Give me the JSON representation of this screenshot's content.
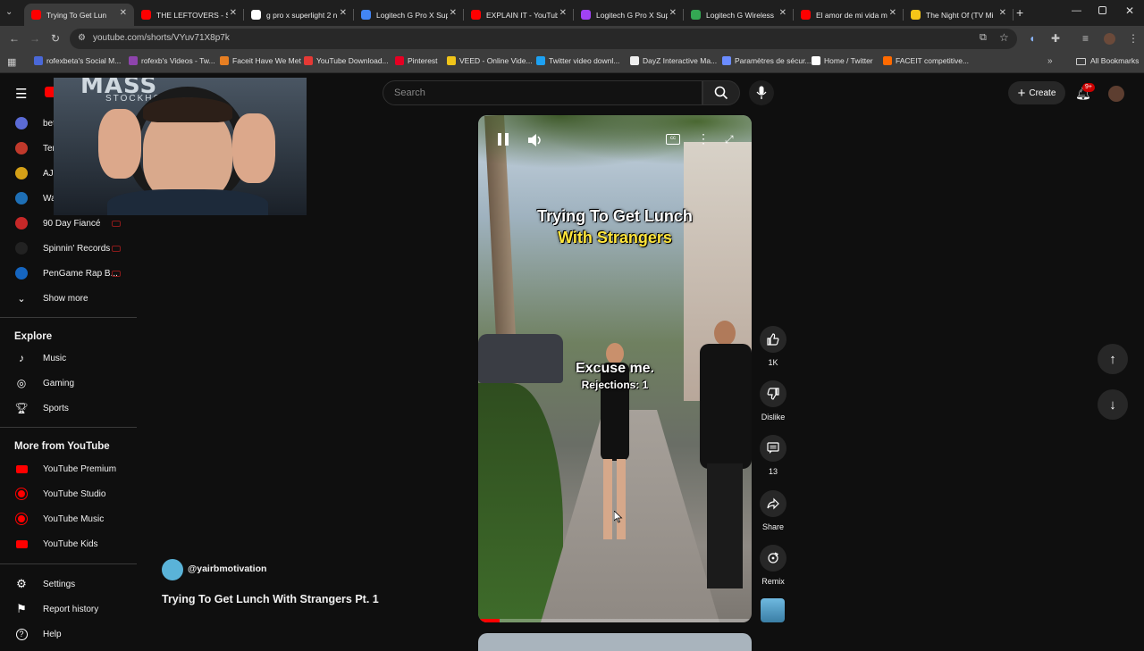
{
  "browser": {
    "tabs": [
      {
        "title": "Trying To Get Lun",
        "color": "#ff0000"
      },
      {
        "title": "THE LEFTOVERS - Sea",
        "color": "#ff0000"
      },
      {
        "title": "g pro x superlight 2 n",
        "color": "#ffffff"
      },
      {
        "title": "Logitech G Pro X Sup",
        "color": "#4285f4"
      },
      {
        "title": "EXPLAIN IT - YouTub",
        "color": "#ff0000"
      },
      {
        "title": "Logitech G Pro X Sup",
        "color": "#a142f4"
      },
      {
        "title": "Logitech G Wireless",
        "color": "#34a853"
      },
      {
        "title": "El amor de mi vida m",
        "color": "#ff0000"
      },
      {
        "title": "The Night Of (TV Mi",
        "color": "#f5c518"
      }
    ],
    "url": "youtube.com/shorts/VYuv71X8p7k",
    "bookmarks": [
      "rofexbeta's Social M...",
      "rofexb's Videos - Tw...",
      "Faceit Have We Met",
      "YouTube Download...",
      "Pinterest",
      "VEED - Online Vide...",
      "Twitter video downl...",
      "DayZ Interactive Ma...",
      "Paramètres de sécur...",
      "Home / Twitter",
      "FACEIT competitive..."
    ],
    "all_bookmarks": "All Bookmarks"
  },
  "header": {
    "search_placeholder": "Search",
    "create_label": "Create",
    "notif_count": "9+"
  },
  "sidebar": {
    "subscriptions": [
      {
        "label": "bet",
        "color": "#5b6bd6"
      },
      {
        "label": "Ter",
        "color": "#c0392b"
      },
      {
        "label": "AJ",
        "color": "#d4a017"
      },
      {
        "label": "Wa",
        "color": "#1e6fb5"
      },
      {
        "label": "90 Day Fiancé",
        "color": "#c62828"
      },
      {
        "label": "Spinnin' Records",
        "color": "#222222"
      },
      {
        "label": "PenGame Rap B...",
        "color": "#1565c0"
      }
    ],
    "show_more": "Show more",
    "explore_title": "Explore",
    "explore": [
      "Music",
      "Gaming",
      "Sports"
    ],
    "more_title": "More from YouTube",
    "more": [
      "YouTube Premium",
      "YouTube Studio",
      "YouTube Music",
      "YouTube Kids"
    ],
    "bottom": [
      "Settings",
      "Report history",
      "Help"
    ]
  },
  "webcam": {
    "text": "MASS",
    "subtext": "STOCKHO"
  },
  "short": {
    "channel": "@yairbmotivation",
    "title": "Trying To Get Lunch With Strangers Pt. 1",
    "caption_top_1": "Trying To Get Lunch",
    "caption_top_2": "With Strangers",
    "caption_mid": "Excuse me.",
    "caption_mid_2": "Rejections: 1",
    "likes": "1K",
    "dislike_label": "Dislike",
    "comments": "13",
    "share_label": "Share",
    "remix_label": "Remix",
    "progress": 0.08
  }
}
